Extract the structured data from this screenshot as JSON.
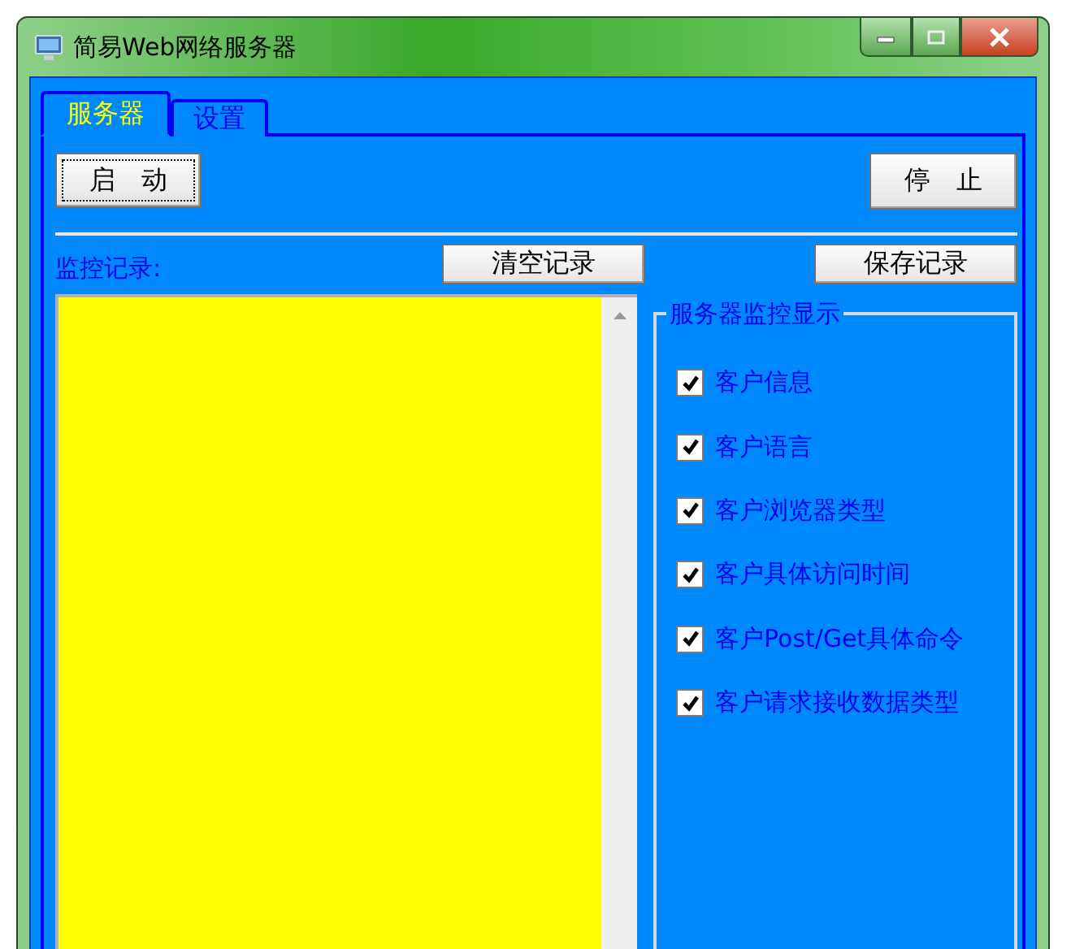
{
  "window": {
    "title": "简易Web网络服务器"
  },
  "tabs": [
    {
      "label": "服务器",
      "selected": true
    },
    {
      "label": "设置",
      "selected": false
    }
  ],
  "start_button": "启　动",
  "stop_button": "停　止",
  "log": {
    "label": "监控记录:",
    "clear_button": "清空记录",
    "save_button": "保存记录"
  },
  "monitor_group": {
    "title": "服务器监控显示",
    "options": [
      {
        "label": "客户信息",
        "checked": true
      },
      {
        "label": "客户语言",
        "checked": true
      },
      {
        "label": "客户浏览器类型",
        "checked": true
      },
      {
        "label": "客户具体访问时间",
        "checked": true
      },
      {
        "label": "客户Post/Get具体命令",
        "checked": true
      },
      {
        "label": "客户请求接收数据类型",
        "checked": true
      }
    ]
  }
}
